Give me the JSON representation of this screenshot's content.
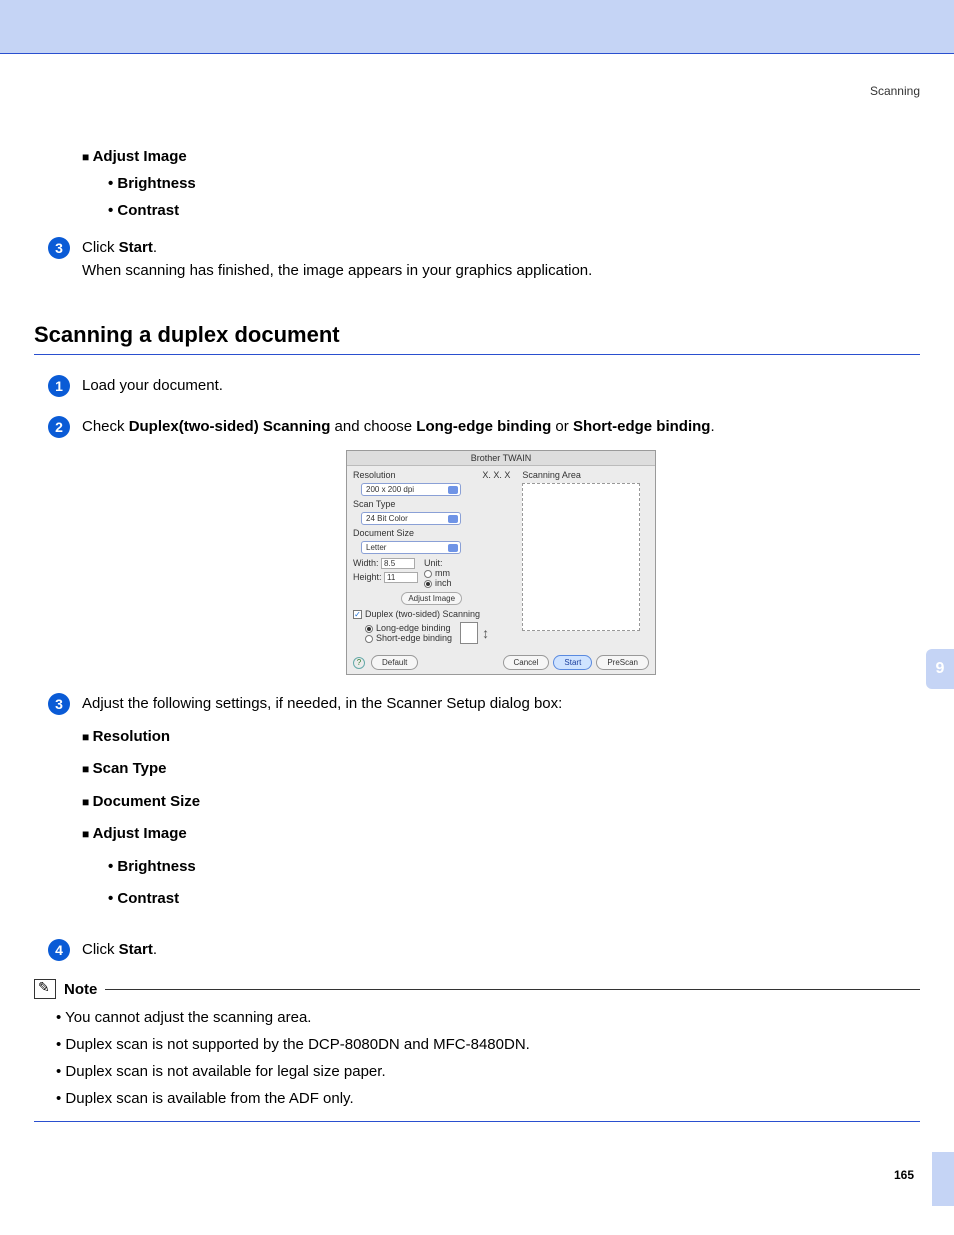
{
  "running_head": "Scanning",
  "top_block": {
    "adjust_image": "Adjust Image",
    "brightness": "Brightness",
    "contrast": "Contrast"
  },
  "step3_pre": {
    "num": "3",
    "click": "Click ",
    "start": "Start",
    "period": ".",
    "line2": "When scanning has finished, the image appears in your graphics application."
  },
  "section_title": "Scanning a duplex document",
  "dstep1": {
    "num": "1",
    "text": "Load your document."
  },
  "dstep2": {
    "num": "2",
    "t1": "Check ",
    "b1": "Duplex(two-sided) Scanning",
    "t2": " and choose ",
    "b2": "Long-edge binding",
    "t3": " or ",
    "b3": "Short-edge binding",
    "t4": "."
  },
  "dialog": {
    "title": "Brother TWAIN",
    "version": "X. X. X",
    "resolution_lbl": "Resolution",
    "resolution_val": "200 x 200 dpi",
    "scantype_lbl": "Scan Type",
    "scantype_val": "24 Bit Color",
    "docsize_lbl": "Document Size",
    "docsize_val": "Letter",
    "width_lbl": "Width:",
    "width_val": "8.5",
    "height_lbl": "Height:",
    "height_val": "11",
    "unit_lbl": "Unit:",
    "unit_mm": "mm",
    "unit_inch": "inch",
    "adjust_btn": "Adjust Image",
    "duplex_chk": "Duplex (two-sided) Scanning",
    "long_edge": "Long-edge binding",
    "short_edge": "Short-edge binding",
    "scanning_area": "Scanning Area",
    "default_btn": "Default",
    "cancel_btn": "Cancel",
    "start_btn": "Start",
    "prescan_btn": "PreScan",
    "help": "?"
  },
  "dstep3": {
    "num": "3",
    "text": "Adjust the following settings, if needed, in the Scanner Setup dialog box:",
    "items": {
      "resolution": "Resolution",
      "scan_type": "Scan Type",
      "doc_size": "Document Size",
      "adjust_image": "Adjust Image",
      "brightness": "Brightness",
      "contrast": "Contrast"
    }
  },
  "dstep4": {
    "num": "4",
    "click": "Click ",
    "start": "Start",
    "period": "."
  },
  "note": {
    "label": "Note",
    "items": [
      "You cannot adjust the scanning area.",
      "Duplex scan is not supported by the DCP-8080DN and MFC-8480DN.",
      "Duplex scan is not available for legal size paper.",
      "Duplex scan is available from the ADF only."
    ]
  },
  "chapter_tab": "9",
  "page_number": "165"
}
